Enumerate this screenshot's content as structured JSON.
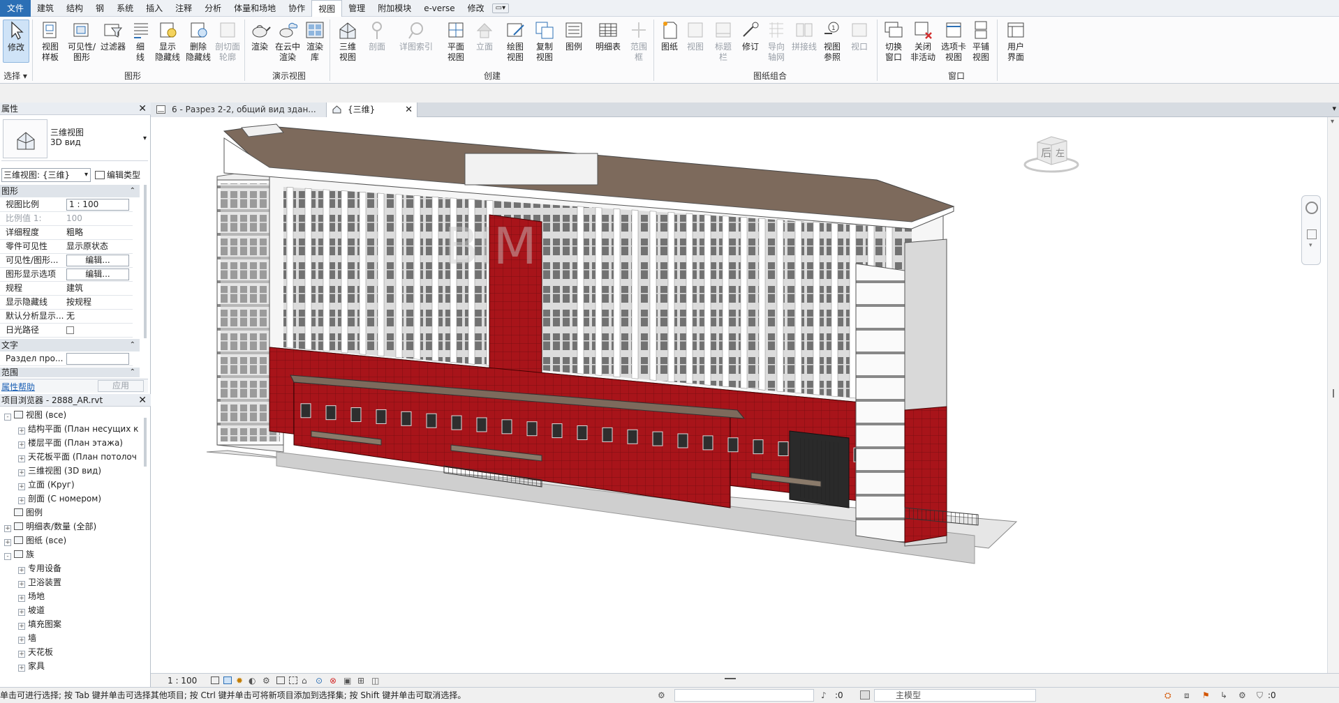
{
  "menu": [
    "文件",
    "建筑",
    "结构",
    "钢",
    "系统",
    "插入",
    "注释",
    "分析",
    "体量和场地",
    "协作",
    "视图",
    "管理",
    "附加模块",
    "e-verse",
    "修改"
  ],
  "ribbon": {
    "buttons": {
      "modify": "修改",
      "view_template": "视图\n样板",
      "visibility": "可见性/\n图形",
      "filters": "过滤器",
      "thin_lines": "细\n线",
      "show_hidden": "显示\n隐藏线",
      "remove_hidden": "删除\n隐藏线",
      "cut_profile": "剖切面\n轮廓",
      "render": "渲染",
      "render_cloud": "在云中\n渲染",
      "render_gallery": "渲染\n库",
      "view_3d": "三维\n视图",
      "section": "剖面",
      "callout": "详图索引",
      "plan_views": "平面\n视图",
      "elevation": "立面",
      "drafting": "绘图\n视图",
      "duplicate": "复制\n视图",
      "legends": "图例",
      "schedules": "明细表",
      "scope_box": "范围\n框",
      "sheet": "图纸",
      "view_btn": "视图",
      "title_block": "标题\n栏",
      "revisions": "修订",
      "guide_grid": "导向\n轴网",
      "matchline": "拼接线",
      "view_reference": "视图\n参照",
      "viewports": "视口",
      "switch_windows": "切换\n窗口",
      "close_inactive": "关闭\n非活动",
      "tab_views": "选项卡\n视图",
      "tile_views": "平铺\n视图",
      "user_interface": "用户\n界面"
    },
    "groups": {
      "select": "选择",
      "graphics": "图形",
      "presentation": "演示视图",
      "create": "创建",
      "sheet_composition": "图纸组合",
      "windows": "窗口"
    }
  },
  "tabs": {
    "tab1": "6 - Разрез 2-2, общий вид здан...",
    "tab2": "{三维}"
  },
  "properties": {
    "header": "属性",
    "type_main": "三维视图",
    "type_sub": "3D вид",
    "selector": "三维视图: {三维}",
    "edit_type": "编辑类型",
    "cat_graphics": "图形",
    "rows": [
      {
        "k": "视图比例",
        "v": "1 : 100"
      },
      {
        "k": "比例值 1:",
        "v": "100"
      },
      {
        "k": "详细程度",
        "v": "粗略"
      },
      {
        "k": "零件可见性",
        "v": "显示原状态"
      },
      {
        "k": "可见性/图形...",
        "v": "编辑..."
      },
      {
        "k": "图形显示选项",
        "v": "编辑..."
      },
      {
        "k": "规程",
        "v": "建筑"
      },
      {
        "k": "显示隐藏线",
        "v": "按规程"
      },
      {
        "k": "默认分析显示...",
        "v": "无"
      },
      {
        "k": "日光路径",
        "v": ""
      }
    ],
    "cat_text": "文字",
    "text_row": "Раздел про...",
    "cat_extents": "范围",
    "help": "属性帮助",
    "apply": "应用"
  },
  "browser": {
    "header": "项目浏览器 - 2888_AR.rvt",
    "items": [
      {
        "t": "视图 (все)",
        "lvl": 0,
        "tog": "-"
      },
      {
        "t": "结构平面 (План несущих к",
        "lvl": 1,
        "tog": "+"
      },
      {
        "t": "楼层平面 (План этажа)",
        "lvl": 1,
        "tog": "+"
      },
      {
        "t": "天花板平面 (План потолоч",
        "lvl": 1,
        "tog": "+"
      },
      {
        "t": "三维视图 (3D вид)",
        "lvl": 1,
        "tog": "+"
      },
      {
        "t": "立面 (Круг)",
        "lvl": 1,
        "tog": "+"
      },
      {
        "t": "剖面 (С номером)",
        "lvl": 1,
        "tog": "+"
      },
      {
        "t": "图例",
        "lvl": 0,
        "tog": ""
      },
      {
        "t": "明细表/数量 (全部)",
        "lvl": 0,
        "tog": "+"
      },
      {
        "t": "图纸 (все)",
        "lvl": 0,
        "tog": "+"
      },
      {
        "t": "族",
        "lvl": 0,
        "tog": "-"
      },
      {
        "t": "专用设备",
        "lvl": 1,
        "tog": "+"
      },
      {
        "t": "卫浴装置",
        "lvl": 1,
        "tog": "+"
      },
      {
        "t": "场地",
        "lvl": 1,
        "tog": "+"
      },
      {
        "t": "坡道",
        "lvl": 1,
        "tog": "+"
      },
      {
        "t": "填充图案",
        "lvl": 1,
        "tog": "+"
      },
      {
        "t": "墙",
        "lvl": 1,
        "tog": "+"
      },
      {
        "t": "天花板",
        "lvl": 1,
        "tog": "+"
      },
      {
        "t": "家具",
        "lvl": 1,
        "tog": "+"
      }
    ]
  },
  "viewcube": {
    "left_face": "后",
    "right_face": "左"
  },
  "viewcontrol": {
    "scale": "1 : 100"
  },
  "status": {
    "text": "单击可进行选择; 按 Tab 键并单击可选择其他项目; 按 Ctrl 键并单击可将新项目添加到选择集; 按 Shift 键并单击可取消选择。",
    "count_a": ":0",
    "model": "主模型",
    "count_b": ":0"
  },
  "colors": {
    "accent": "#2b6fb5",
    "brick": "#a8141a",
    "roof": "#7d6a5c",
    "sel_btn": "#cfe3f7"
  }
}
